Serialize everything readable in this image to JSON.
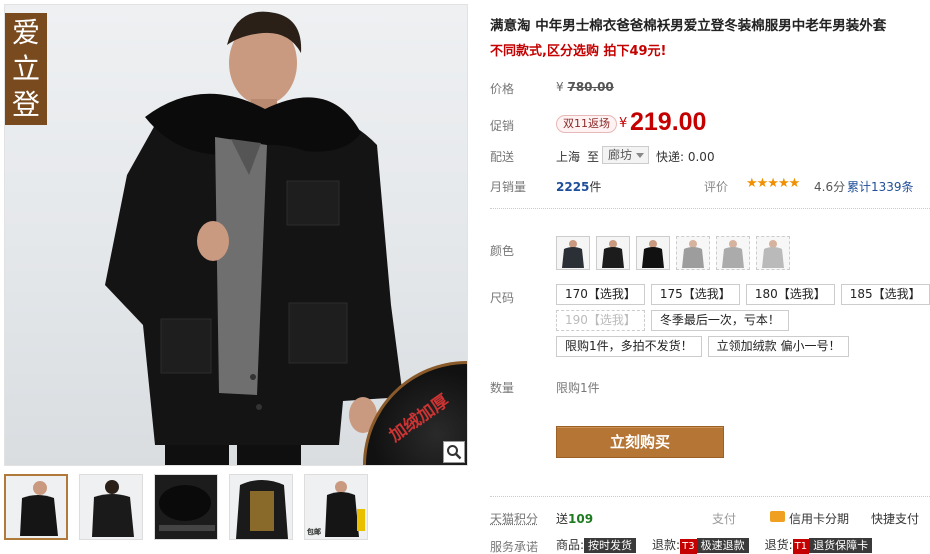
{
  "gallery": {
    "brand_logo_text": "爱立登",
    "fur_badge_text": "加绒加厚",
    "zoom_icon": "magnifier-icon",
    "thumbnails": [
      {
        "name": "front-view",
        "active": true
      },
      {
        "name": "back-view",
        "active": false
      },
      {
        "name": "collar-detail",
        "active": false
      },
      {
        "name": "lining-detail",
        "active": false
      },
      {
        "name": "promo-shot",
        "active": false,
        "caption": "包邮"
      }
    ]
  },
  "product": {
    "title": "满意淘 中年男士棉衣爸爸棉袄男爱立登冬装棉服男中老年男装外套",
    "promo_line": "不同款式,区分选购 拍下49元!"
  },
  "price": {
    "label": "价格",
    "currency": "¥",
    "original": "780.00"
  },
  "promotion": {
    "label": "促销",
    "badge": "双11返场",
    "currency": "¥",
    "price": "219.00"
  },
  "delivery": {
    "label": "配送",
    "from": "上海",
    "to_word": "至",
    "to": "廊坊",
    "fee": "快递: 0.00"
  },
  "sales": {
    "label": "月销量",
    "count": "2225",
    "unit": "件",
    "rating_label": "评价",
    "stars": "★★★★★",
    "score": "4.6分",
    "reviews": "累计1339条"
  },
  "color": {
    "label": "颜色",
    "swatches": [
      "black-coat",
      "black-coat-fur",
      "black-coat-dark",
      "gray-coat",
      "gray-coat-light",
      "gray-coat-pale"
    ]
  },
  "size": {
    "label": "尺码",
    "options": [
      {
        "text": "170【选我】",
        "disabled": false
      },
      {
        "text": "175【选我】",
        "disabled": false
      },
      {
        "text": "180【选我】",
        "disabled": false
      },
      {
        "text": "185【选我】",
        "disabled": false
      },
      {
        "text": "190【选我】",
        "disabled": true
      },
      {
        "text": "冬季最后一次，亏本！",
        "disabled": false
      },
      {
        "text": "限购1件，多拍不发货！",
        "disabled": false
      },
      {
        "text": "立领加绒款 偏小一号！",
        "disabled": false
      }
    ]
  },
  "quantity": {
    "label": "数量",
    "value": "限购1件"
  },
  "buy_button": "立刻购买",
  "points": {
    "label": "天猫积分",
    "prefix": "送",
    "value": "109",
    "pay_label": "支付",
    "installment": "信用卡分期",
    "quick_pay": "快捷支付"
  },
  "service": {
    "label": "服务承诺",
    "items": [
      {
        "prefix": "商品:",
        "code": "",
        "tag": "按时发货"
      },
      {
        "prefix": "退款:",
        "code": "T3",
        "tag": "极速退款"
      },
      {
        "prefix": "退货:",
        "code": "T1",
        "tag": "退货保障卡"
      }
    ]
  },
  "colors": {
    "accent_red": "#c40000",
    "buy_button": "#b57535",
    "brand_brown": "#7a4a1f",
    "link_blue": "#1f4e9a"
  }
}
